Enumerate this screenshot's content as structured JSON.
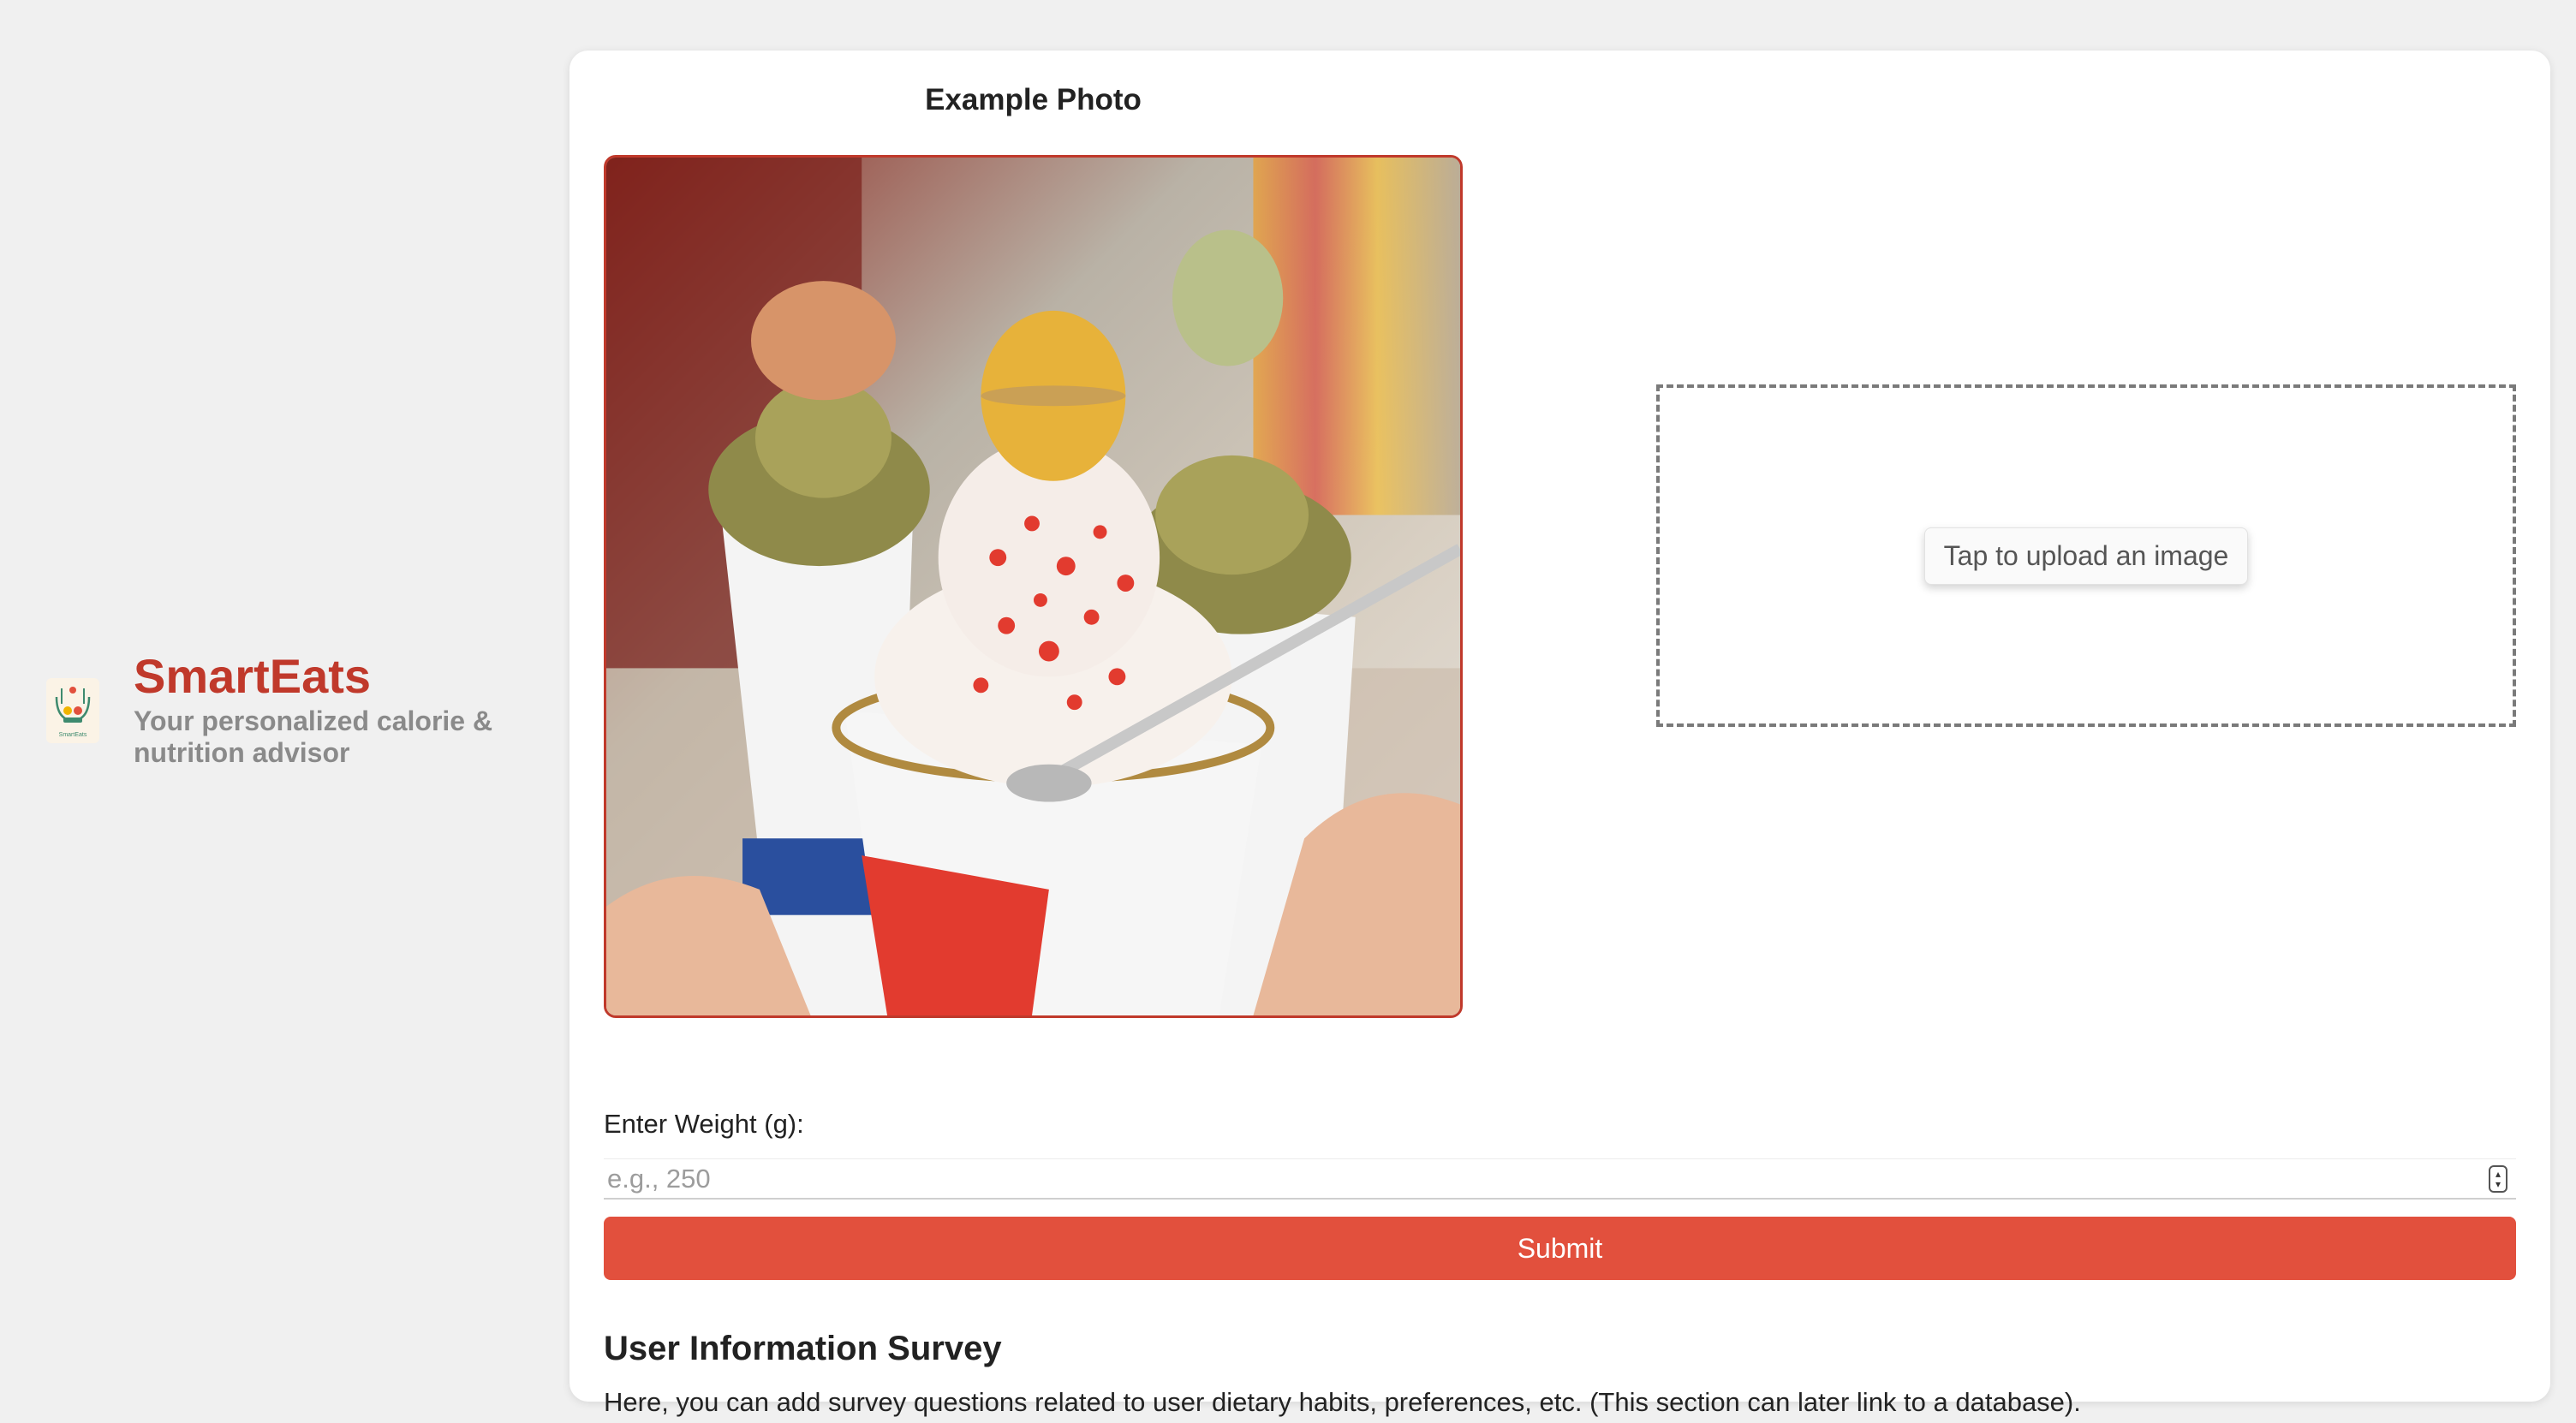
{
  "sidebar": {
    "brand_name": "SmartEats",
    "tagline": "Your personalized calorie & nutrition advisor",
    "logo_icon": "smarteats-logo",
    "logo_text": "SmartEats"
  },
  "main": {
    "example_title": "Example Photo",
    "example_photo_icon": "ice-cream-macaron-photo",
    "upload": {
      "button_label": "Tap to upload an image"
    },
    "weight": {
      "label": "Enter Weight (g):",
      "placeholder": "e.g., 250",
      "value": ""
    },
    "submit_label": "Submit",
    "survey": {
      "title": "User Information Survey",
      "description": "Here, you can add survey questions related to user dietary habits, preferences, etc. (This section can later link to a database)."
    }
  },
  "colors": {
    "brand": "#c0392b",
    "submit": "#e2503d",
    "background": "#f0f0f0",
    "card": "#ffffff"
  }
}
